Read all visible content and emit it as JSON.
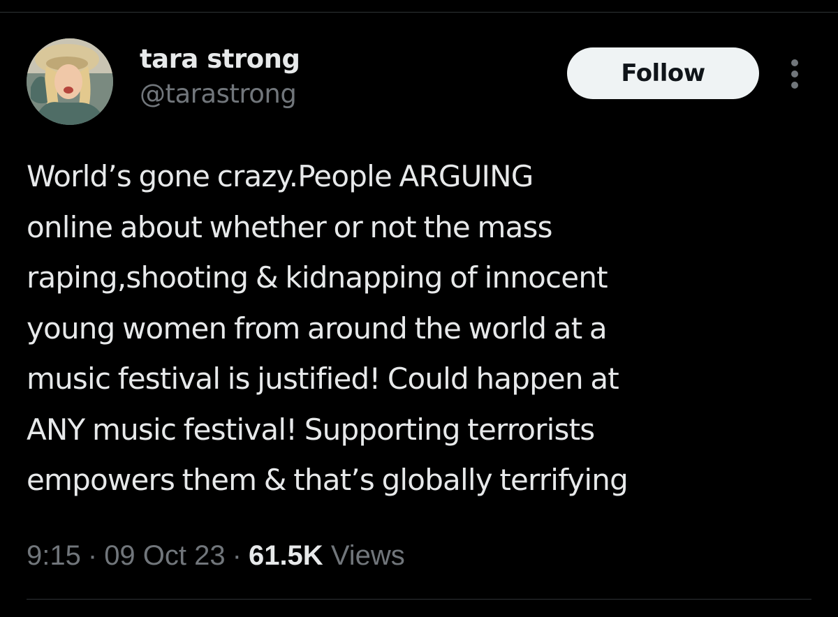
{
  "author": {
    "display_name": "tara strong",
    "handle": "@tarastrong"
  },
  "actions": {
    "follow_label": "Follow",
    "more_icon": "more-vertical-icon"
  },
  "tweet": {
    "lines": [
      "World’s gone crazy.People ARGUING",
      "online about whether or not the mass",
      "raping,shooting & kidnapping of innocent",
      "young women from around the world at a",
      "music festival is justified! Could happen at",
      "ANY music festival! Supporting terrorists",
      "empowers them & that’s globally terrifying"
    ]
  },
  "meta": {
    "time": "9:15",
    "separator": "·",
    "date": "09 Oct 23",
    "views_count": "61.5K",
    "views_label": "Views"
  },
  "colors": {
    "background": "#000000",
    "text_primary": "#e7e9ea",
    "text_secondary": "#71767b",
    "follow_bg": "#eff3f4",
    "divider": "#2f3336"
  }
}
